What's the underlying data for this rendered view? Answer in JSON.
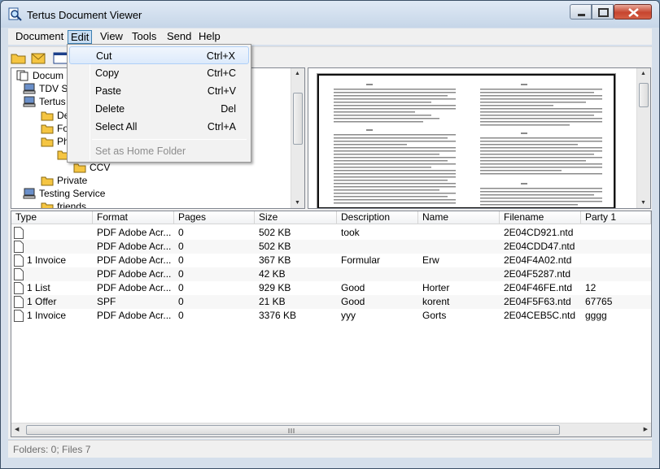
{
  "window": {
    "title": "Tertus Document Viewer"
  },
  "menubar": [
    "Document",
    "Edit",
    "View",
    "Tools",
    "Send",
    "Help"
  ],
  "edit_menu": {
    "items": [
      {
        "label": "Cut",
        "shortcut": "Ctrl+X"
      },
      {
        "label": "Copy",
        "shortcut": "Ctrl+C"
      },
      {
        "label": "Paste",
        "shortcut": "Ctrl+V"
      },
      {
        "label": "Delete",
        "shortcut": "Del"
      },
      {
        "label": "Select All",
        "shortcut": "Ctrl+A"
      }
    ],
    "disabled_item": "Set as Home Folder"
  },
  "tree": {
    "items": [
      {
        "label": "Docum",
        "icon": "document-stack-icon"
      },
      {
        "label": "TDV S",
        "icon": "computer-icon"
      },
      {
        "label": "Tertus",
        "icon": "computer-icon"
      },
      {
        "label": "De",
        "icon": "folder-icon"
      },
      {
        "label": "Fo",
        "icon": "folder-icon"
      },
      {
        "label": "Ph",
        "icon": "folder-icon"
      },
      {
        "label": "",
        "icon": "folder-icon"
      },
      {
        "label": "CCV",
        "icon": "folder-icon"
      },
      {
        "label": "Private",
        "icon": "folder-icon"
      },
      {
        "label": "Testing Service",
        "icon": "computer-icon"
      },
      {
        "label": "friends",
        "icon": "folder-icon"
      }
    ]
  },
  "table": {
    "columns": [
      "Type",
      "Format",
      "Pages",
      "Size",
      "Description",
      "Name",
      "Filename",
      "Party 1"
    ],
    "rows": [
      [
        "",
        "PDF Adobe Acr...",
        "0",
        "502 KB",
        "took",
        "",
        "2E04CD921.ntd",
        ""
      ],
      [
        "",
        "PDF Adobe Acr...",
        "0",
        "502 KB",
        "",
        "",
        "2E04CDD47.ntd",
        ""
      ],
      [
        "1 Invoice",
        "PDF Adobe Acr...",
        "0",
        "367 KB",
        "Formular",
        "Erw",
        "2E04F4A02.ntd",
        ""
      ],
      [
        "",
        "PDF Adobe Acr...",
        "0",
        "42 KB",
        "",
        "",
        "2E04F5287.ntd",
        ""
      ],
      [
        "1 List",
        "PDF Adobe Acr...",
        "0",
        "929 KB",
        "Good",
        "Horter",
        "2E04F46FE.ntd",
        "12"
      ],
      [
        "1 Offer",
        "SPF",
        "0",
        "21 KB",
        "Good",
        "korent",
        "2E04F5F63.ntd",
        "67765"
      ],
      [
        "1 Invoice",
        "PDF Adobe Acr...",
        "0",
        "3376 KB",
        "yyy",
        "Gorts",
        "2E04CEB5C.ntd",
        "gggg"
      ]
    ]
  },
  "status": {
    "text": "Folders: 0; Files 7"
  },
  "colors": {
    "titlebar": "#c6d6e8",
    "menu_highlight": "#dceafb",
    "folder": "#f5c542",
    "close_button": "#c7452f"
  }
}
